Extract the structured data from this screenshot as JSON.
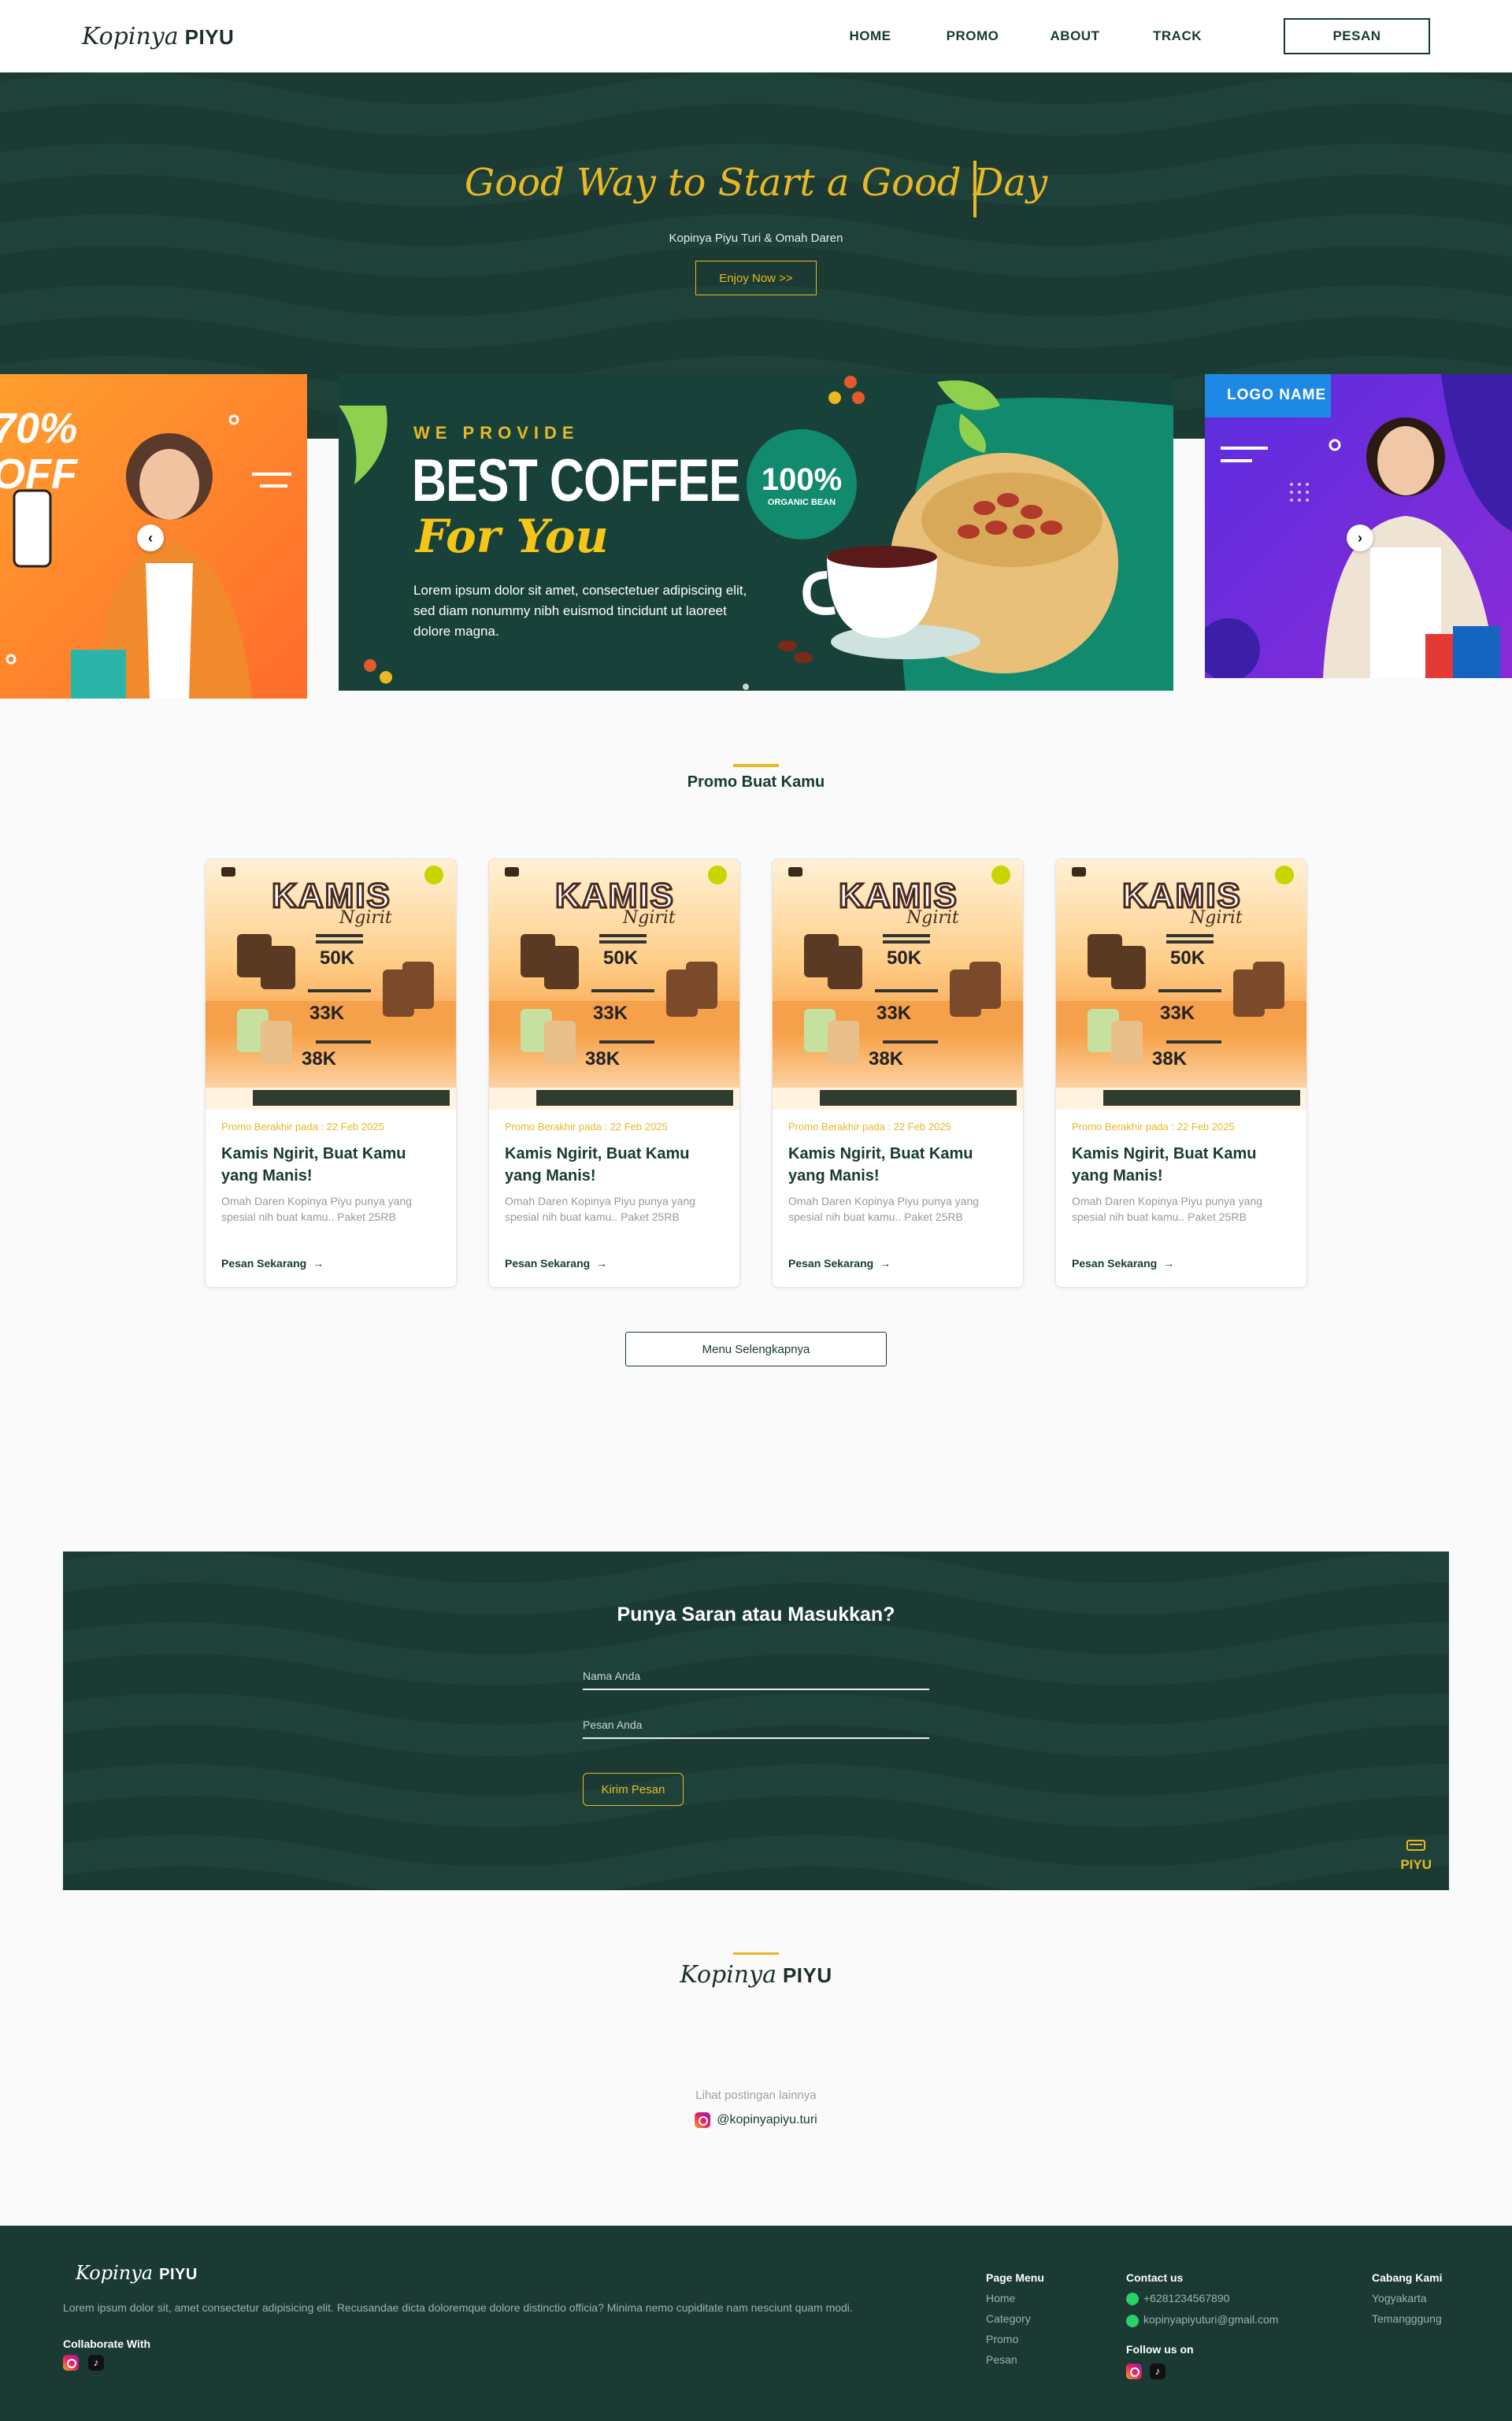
{
  "nav": {
    "logo_script": "Kopinya",
    "logo_bold": "PIYU",
    "items": [
      {
        "label": "HOME"
      },
      {
        "label": "PROMO"
      },
      {
        "label": "ABOUT"
      },
      {
        "label": "TRACK"
      }
    ],
    "cta_label": "PESAN"
  },
  "hero": {
    "title": "Good Way to Start a Good Day",
    "subtitle": "Kopinya Piyu Turi & Omah Daren",
    "button": "Enjoy Now >>"
  },
  "banner_left": {
    "big_text_1": "70%",
    "big_text_2": "OFF"
  },
  "banner_main": {
    "eyebrow": "WE PROVIDE",
    "headline": "BEST COFFEE",
    "script": "For You",
    "body": "Lorem ipsum dolor sit amet, consectetuer adipiscing elit, sed diam nonummy nibh euismod tincidunt ut laoreet dolore magna.",
    "badge_big": "100%",
    "badge_small": "ORGANIC BEAN"
  },
  "banner_right": {
    "logo_label": "LOGO NAME"
  },
  "promo": {
    "title": "Promo Buat Kamu",
    "cards": [
      {
        "poster_title": "KAMIS",
        "poster_subtitle": "Ngirit",
        "price_1": "50K",
        "price_2": "33K",
        "price_3": "38K",
        "date": "Promo Berakhir pada : 22 Feb 2025",
        "title": "Kamis Ngirit, Buat Kamu yang Manis!",
        "desc": "Omah Daren Kopinya Piyu punya yang spesial nih buat kamu.. Paket 25RB",
        "cta": "Pesan Sekarang"
      },
      {
        "poster_title": "KAMIS",
        "poster_subtitle": "Ngirit",
        "price_1": "50K",
        "price_2": "33K",
        "price_3": "38K",
        "date": "Promo Berakhir pada : 22 Feb 2025",
        "title": "Kamis Ngirit, Buat Kamu yang Manis!",
        "desc": "Omah Daren Kopinya Piyu punya yang spesial nih buat kamu.. Paket 25RB",
        "cta": "Pesan Sekarang"
      },
      {
        "poster_title": "KAMIS",
        "poster_subtitle": "Ngirit",
        "price_1": "50K",
        "price_2": "33K",
        "price_3": "38K",
        "date": "Promo Berakhir pada : 22 Feb 2025",
        "title": "Kamis Ngirit, Buat Kamu yang Manis!",
        "desc": "Omah Daren Kopinya Piyu punya yang spesial nih buat kamu.. Paket 25RB",
        "cta": "Pesan Sekarang"
      },
      {
        "poster_title": "KAMIS",
        "poster_subtitle": "Ngirit",
        "price_1": "50K",
        "price_2": "33K",
        "price_3": "38K",
        "date": "Promo Berakhir pada : 22 Feb 2025",
        "title": "Kamis Ngirit, Buat Kamu yang Manis!",
        "desc": "Omah Daren Kopinya Piyu punya yang spesial nih buat kamu.. Paket 25RB",
        "cta": "Pesan Sekarang"
      }
    ],
    "more_button": "Menu Selengkapnya"
  },
  "feedback": {
    "title": "Punya Saran atau Masukkan?",
    "name_placeholder": "Nama Anda",
    "message_placeholder": "Pesan Anda",
    "submit": "Kirim Pesan",
    "badge_label": "PIYU"
  },
  "instagram": {
    "logo_script": "Kopinya",
    "logo_bold": "PIYU",
    "more_label": "Lihat postingan lainnya",
    "handle": "@kopinyapiyu.turi"
  },
  "footer": {
    "logo_script": "Kopinya",
    "logo_bold": "PIYU",
    "description": "Lorem ipsum dolor sit, amet consectetur adipisicing elit. Recusandae dicta doloremque dolore distinctio officia? Minima nemo cupiditate nam nesciunt quam modi.",
    "collab_title": "Collaborate With",
    "page_menu": {
      "title": "Page Menu",
      "items": [
        "Home",
        "Category",
        "Promo",
        "Pesan"
      ]
    },
    "contact": {
      "title": "Contact us",
      "phone": "+6281234567890",
      "email": "kopinyapiyuturi@gmail.com",
      "follow_title": "Follow us on"
    },
    "branches": {
      "title": "Cabang Kami",
      "items": [
        "Yogyakarta",
        "Temangggung"
      ]
    }
  },
  "colors": {
    "brand_green": "#1a3a33",
    "accent_gold": "#e9b824"
  }
}
